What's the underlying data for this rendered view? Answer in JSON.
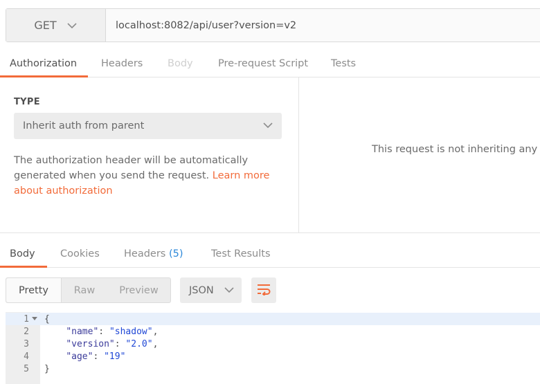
{
  "request": {
    "method": "GET",
    "url": "localhost:8082/api/user?version=v2"
  },
  "request_tabs": [
    {
      "label": "Authorization",
      "state": "active"
    },
    {
      "label": "Headers",
      "state": "normal"
    },
    {
      "label": "Body",
      "state": "disabled"
    },
    {
      "label": "Pre-request Script",
      "state": "normal"
    },
    {
      "label": "Tests",
      "state": "normal"
    }
  ],
  "auth": {
    "type_label": "TYPE",
    "selected_type": "Inherit auth from parent",
    "description": "The authorization header will be automatically generated when you send the request.",
    "learn_more_link": "Learn more about authorization",
    "right_message": "This request is not inheriting any authorization helper at the moment."
  },
  "response_tabs": [
    {
      "label": "Body",
      "state": "active"
    },
    {
      "label": "Cookies",
      "state": "normal"
    },
    {
      "label": "Headers",
      "count": "(5)",
      "state": "normal"
    },
    {
      "label": "Test Results",
      "state": "normal"
    }
  ],
  "response_toolbar": {
    "views": [
      "Pretty",
      "Raw",
      "Preview"
    ],
    "active_view": "Pretty",
    "format": "JSON"
  },
  "editor": {
    "lines": [
      {
        "n": "1",
        "tokens": [
          [
            "p",
            "{"
          ]
        ]
      },
      {
        "n": "2",
        "tokens": [
          [
            "p",
            "    "
          ],
          [
            "k",
            "\"name\""
          ],
          [
            "p",
            ": "
          ],
          [
            "s",
            "\"shadow\""
          ],
          [
            "p",
            ","
          ]
        ]
      },
      {
        "n": "3",
        "tokens": [
          [
            "p",
            "    "
          ],
          [
            "k",
            "\"version\""
          ],
          [
            "p",
            ": "
          ],
          [
            "s",
            "\"2.0\""
          ],
          [
            "p",
            ","
          ]
        ]
      },
      {
        "n": "4",
        "tokens": [
          [
            "p",
            "    "
          ],
          [
            "k",
            "\"age\""
          ],
          [
            "p",
            ": "
          ],
          [
            "s",
            "\"19\""
          ]
        ]
      },
      {
        "n": "5",
        "tokens": [
          [
            "p",
            "}"
          ]
        ]
      }
    ]
  },
  "colors": {
    "accent": "#f26b3a",
    "count": "#2c88d9"
  }
}
